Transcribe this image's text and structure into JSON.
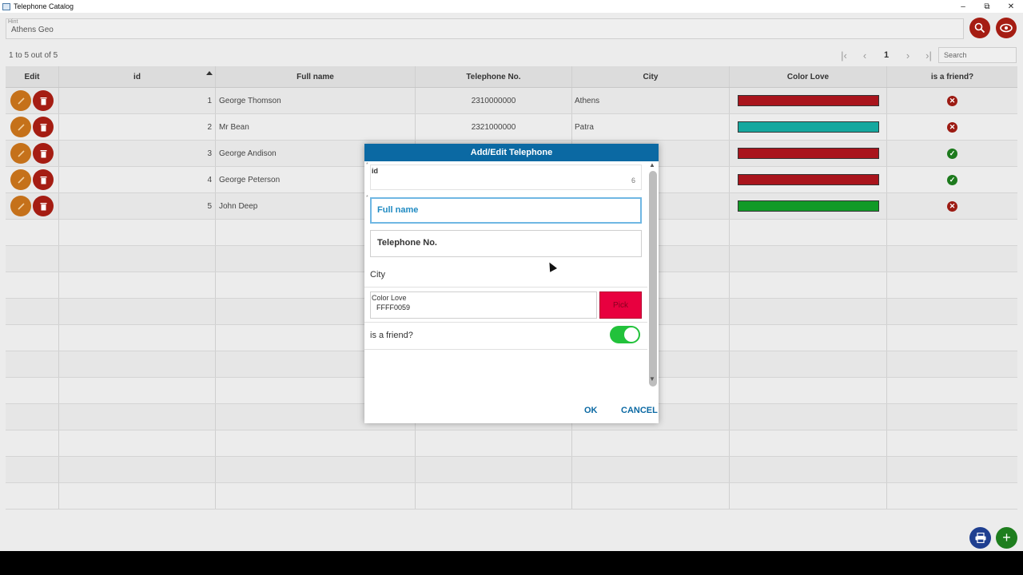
{
  "window": {
    "title": "Telephone Catalog",
    "minimize_icon": "minimize-icon",
    "restore_icon": "restore-icon",
    "close_icon": "close-icon"
  },
  "toolbar": {
    "hint_label": "Hint",
    "hint_value": "Athens Geo",
    "search_icon": "search-icon",
    "eye_icon": "eye-icon"
  },
  "pager": {
    "info": "1 to 5 out of 5",
    "page": "1",
    "search_placeholder": "Search"
  },
  "grid": {
    "columns": [
      "Edit",
      "id",
      "Full name",
      "Telephone No.",
      "City",
      "Color Love",
      "is a friend?"
    ],
    "sorted_column": "id",
    "rows": [
      {
        "id": "1",
        "name": "George Thomson",
        "phone": "2310000000",
        "city": "Athens",
        "color": "#a9141c",
        "friend": false
      },
      {
        "id": "2",
        "name": "Mr Bean",
        "phone": "2321000000",
        "city": "Patra",
        "color": "#16a89f",
        "friend": false
      },
      {
        "id": "3",
        "name": "George Andison",
        "phone": "",
        "city": "",
        "color": "#a9141c",
        "friend": true
      },
      {
        "id": "4",
        "name": "George Peterson",
        "phone": "",
        "city": "",
        "color": "#a9141c",
        "friend": true
      },
      {
        "id": "5",
        "name": "John Deep",
        "phone": "",
        "city": "",
        "color": "#119a27",
        "friend": false
      }
    ]
  },
  "dialog": {
    "title": "Add/Edit Telephone",
    "id_label": "id",
    "id_value": "6",
    "fullname_placeholder": "Full name",
    "phone_placeholder": "Telephone No.",
    "city_label": "City",
    "color_label": "Color Love",
    "color_value": "FFFF0059",
    "pick_label": "Pick",
    "friend_label": "is a friend?",
    "friend_on": true,
    "ok_label": "OK",
    "cancel_label": "CANCEL"
  },
  "colors": {
    "accent": "#0b69a3",
    "danger": "#a51d13",
    "edit": "#c5711a",
    "toggle_on": "#22c23b",
    "pick": "#e8003f"
  }
}
